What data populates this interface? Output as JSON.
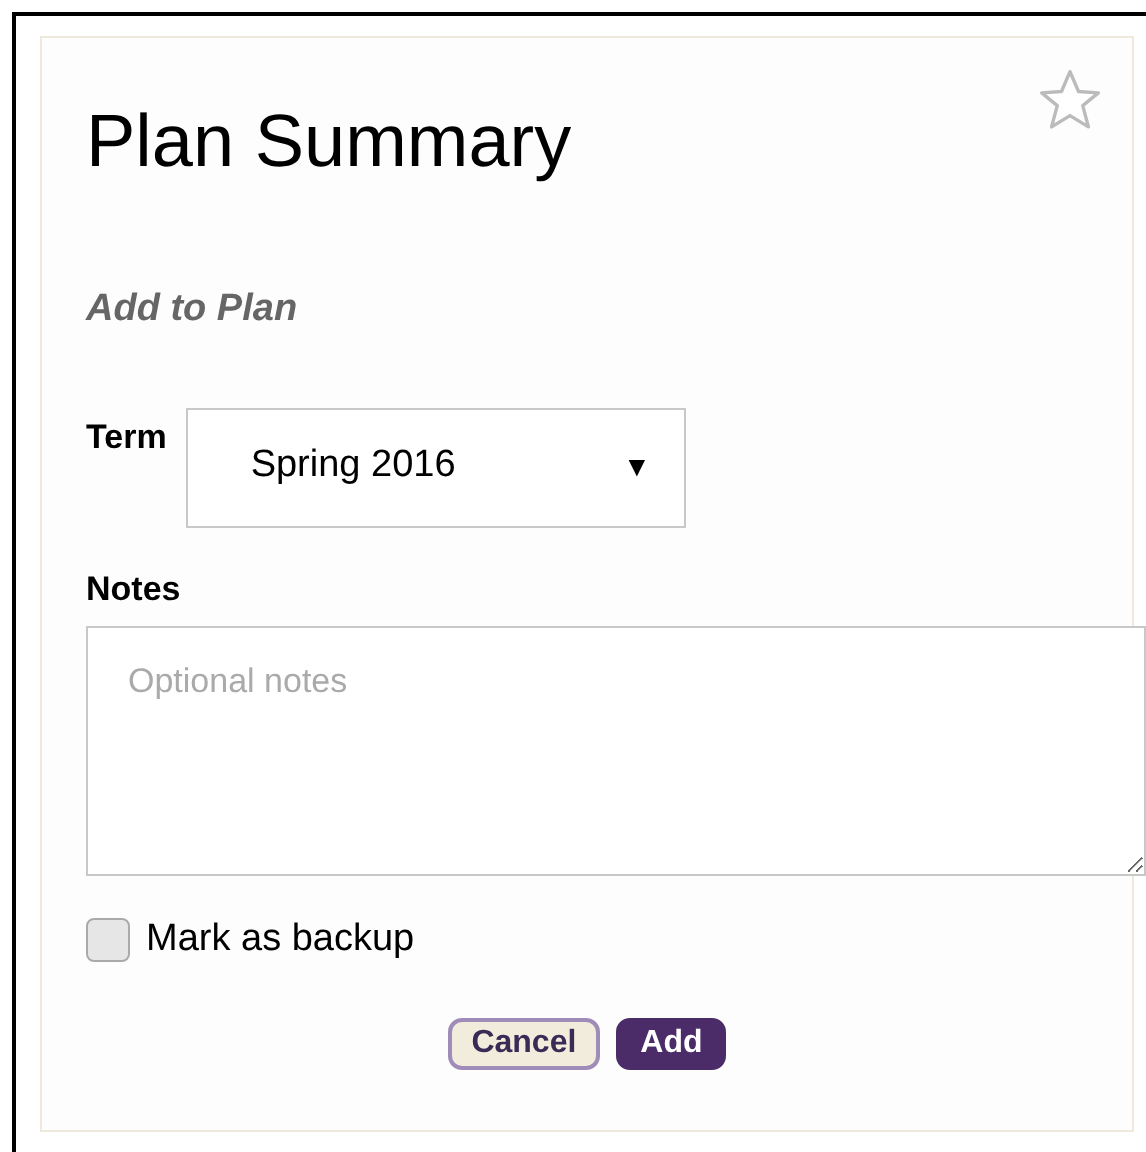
{
  "title": "Plan Summary",
  "favorite": false,
  "section_heading": "Add to Plan",
  "term": {
    "label": "Term",
    "value": "Spring 2016",
    "arrow": "▼"
  },
  "notes": {
    "label": "Notes",
    "placeholder": "Optional notes"
  },
  "backup": {
    "label": "Mark as backup",
    "checked": false
  },
  "buttons": [
    {
      "label": "Cancel",
      "kind": "secondary"
    },
    {
      "label": "Add",
      "kind": "primary"
    }
  ]
}
